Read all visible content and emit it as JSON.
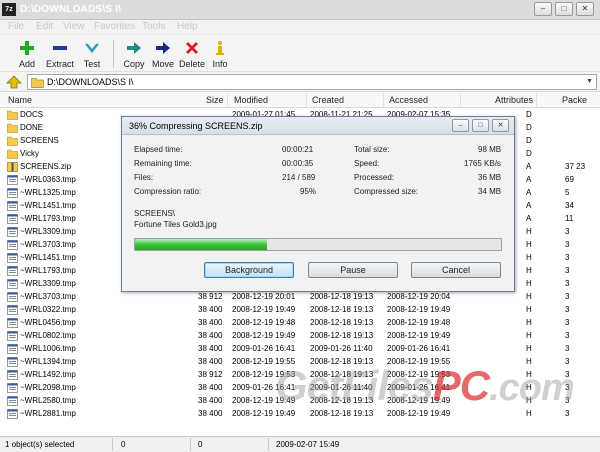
{
  "window": {
    "title": "D:\\DOWNLOADS\\S I\\",
    "app_icon": "7z",
    "buttons": [
      "minimize",
      "maximize",
      "close"
    ]
  },
  "menu": [
    "File",
    "Edit",
    "View",
    "Favorites",
    "Tools",
    "Help"
  ],
  "toolbar": [
    {
      "label": "Add",
      "icon": "plus-icon",
      "color": "#22aa22"
    },
    {
      "label": "Extract",
      "icon": "minus-icon",
      "color": "#1c3c9c"
    },
    {
      "label": "Test",
      "icon": "check-icon",
      "color": "#2a9ab8"
    },
    {
      "label": "Copy",
      "icon": "copy-arrow-icon",
      "color": "#1e8a8a"
    },
    {
      "label": "Move",
      "icon": "move-arrow-icon",
      "color": "#1c2a8c"
    },
    {
      "label": "Delete",
      "icon": "delete-x-icon",
      "color": "#d82020"
    },
    {
      "label": "Info",
      "icon": "info-icon",
      "color": "#e0b000"
    }
  ],
  "address": {
    "path": "D:\\DOWNLOADS\\S I\\"
  },
  "columns": [
    "Name",
    "Size",
    "Modified",
    "Created",
    "Accessed",
    "Attributes",
    "Packe"
  ],
  "files": [
    {
      "name": "DOCS",
      "type": "folder",
      "size": "",
      "modified": "2009-01-27 01:45",
      "created": "2008-11-21 21:25",
      "accessed": "2009-02-07 15:35",
      "attr": "D",
      "packed": ""
    },
    {
      "name": "DONE",
      "type": "folder",
      "size": "",
      "modified": "",
      "created": "",
      "accessed": "",
      "attr": "D",
      "packed": ""
    },
    {
      "name": "SCREENS",
      "type": "folder",
      "size": "",
      "modified": "",
      "created": "",
      "accessed": "",
      "attr": "D",
      "packed": ""
    },
    {
      "name": "Vicky",
      "type": "folder",
      "size": "",
      "modified": "",
      "created": "",
      "accessed": "",
      "attr": "D",
      "packed": ""
    },
    {
      "name": "SCREENS.zip",
      "type": "zip",
      "size": "",
      "modified": "",
      "created": "",
      "accessed": "",
      "attr": "A",
      "packed": "37 23"
    },
    {
      "name": "~WRL0363.tmp",
      "type": "file",
      "size": "",
      "modified": "",
      "created": "",
      "accessed": "",
      "attr": "A",
      "packed": "69"
    },
    {
      "name": "~WRL1325.tmp",
      "type": "file",
      "size": "",
      "modified": "",
      "created": "",
      "accessed": "",
      "attr": "A",
      "packed": "5"
    },
    {
      "name": "~WRL1451.tmp",
      "type": "file",
      "size": "",
      "modified": "",
      "created": "",
      "accessed": "",
      "attr": "A",
      "packed": "34"
    },
    {
      "name": "~WRL1793.tmp",
      "type": "file",
      "size": "",
      "modified": "",
      "created": "",
      "accessed": "",
      "attr": "A",
      "packed": "11"
    },
    {
      "name": "~WRL3309.tmp",
      "type": "file",
      "size": "",
      "modified": "",
      "created": "",
      "accessed": "",
      "attr": "H",
      "packed": "3"
    },
    {
      "name": "~WRL3703.tmp",
      "type": "file",
      "size": "",
      "modified": "",
      "created": "",
      "accessed": "",
      "attr": "H",
      "packed": "3"
    },
    {
      "name": "~WRL1451.tmp",
      "type": "file",
      "size": "",
      "modified": "",
      "created": "",
      "accessed": "",
      "attr": "H",
      "packed": "3"
    },
    {
      "name": "~WRL1793.tmp",
      "type": "file",
      "size": "",
      "modified": "",
      "created": "",
      "accessed": "",
      "attr": "H",
      "packed": "3"
    },
    {
      "name": "~WRL3309.tmp",
      "type": "file",
      "size": "",
      "modified": "",
      "created": "",
      "accessed": "",
      "attr": "H",
      "packed": "3"
    },
    {
      "name": "~WRL3703.tmp",
      "type": "file",
      "size": "38 912",
      "modified": "2008-12-19 20:01",
      "created": "2008-12-18 19:13",
      "accessed": "2008-12-19 20:04",
      "attr": "H",
      "packed": "3"
    },
    {
      "name": "~WRL0322.tmp",
      "type": "file",
      "size": "38 400",
      "modified": "2008-12-19 19:49",
      "created": "2008-12-18 19:13",
      "accessed": "2008-12-19 19:49",
      "attr": "H",
      "packed": "3"
    },
    {
      "name": "~WRL0456.tmp",
      "type": "file",
      "size": "38 400",
      "modified": "2008-12-19 19:48",
      "created": "2008-12-18 19:13",
      "accessed": "2008-12-19 19:48",
      "attr": "H",
      "packed": "3"
    },
    {
      "name": "~WRL0802.tmp",
      "type": "file",
      "size": "38 400",
      "modified": "2008-12-19 19:49",
      "created": "2008-12-18 19:13",
      "accessed": "2008-12-19 19:49",
      "attr": "H",
      "packed": "3"
    },
    {
      "name": "~WRL1006.tmp",
      "type": "file",
      "size": "38 400",
      "modified": "2009-01-26 16:41",
      "created": "2009-01-26 11:40",
      "accessed": "2009-01-26 16:41",
      "attr": "H",
      "packed": "3"
    },
    {
      "name": "~WRL1394.tmp",
      "type": "file",
      "size": "38 400",
      "modified": "2008-12-19 19:55",
      "created": "2008-12-18 19:13",
      "accessed": "2008-12-19 19:55",
      "attr": "H",
      "packed": "3"
    },
    {
      "name": "~WRL1492.tmp",
      "type": "file",
      "size": "38 912",
      "modified": "2008-12-19 19:53",
      "created": "2008-12-18 19:13",
      "accessed": "2008-12-19 19:53",
      "attr": "H",
      "packed": "3"
    },
    {
      "name": "~WRL2098.tmp",
      "type": "file",
      "size": "38 400",
      "modified": "2009-01-26 16:41",
      "created": "2009-01-26 11:40",
      "accessed": "2009-01-26 16:41",
      "attr": "H",
      "packed": "3"
    },
    {
      "name": "~WRL2580.tmp",
      "type": "file",
      "size": "38 400",
      "modified": "2008-12-19 19:49",
      "created": "2008-12-18 19:13",
      "accessed": "2008-12-19 19:49",
      "attr": "H",
      "packed": "3"
    },
    {
      "name": "~WRL2881.tmp",
      "type": "file",
      "size": "38 400",
      "modified": "2008-12-19 19:49",
      "created": "2008-12-18 19:13",
      "accessed": "2008-12-19 19:49",
      "attr": "H",
      "packed": "3"
    }
  ],
  "status": {
    "selected": "1 object(s) selected",
    "size": "0",
    "packed": "0",
    "modified": "2009-02-07 15:49"
  },
  "dialog": {
    "title": "36% Compressing SCREENS.zip",
    "stats_left": [
      {
        "label": "Elapsed time:",
        "value": "00:00:21"
      },
      {
        "label": "Remaining time:",
        "value": "00:00:35"
      },
      {
        "label": "Files:",
        "value": "214 / 589"
      },
      {
        "label": "Compression ratio:",
        "value": "95%"
      }
    ],
    "stats_right": [
      {
        "label": "Total size:",
        "value": "98 MB"
      },
      {
        "label": "Speed:",
        "value": "1765 KB/s"
      },
      {
        "label": "Processed:",
        "value": "36 MB"
      },
      {
        "label": "Compressed size:",
        "value": "34 MB"
      }
    ],
    "current_folder": "SCREENS\\",
    "current_file": "Fortune Tiles Gold3.jpg",
    "progress_percent": 36,
    "buttons": {
      "background": "Background",
      "pause": "Pause",
      "cancel": "Cancel"
    }
  },
  "watermark": {
    "part1": "Get",
    "part2": "Files",
    "part3": "PC",
    "part4": ".com"
  },
  "colors": {
    "titlebar": "#dcdcdc",
    "progress": "#2fb52f",
    "watermark_red": "#dc2828",
    "folder": "#f2c94c"
  }
}
